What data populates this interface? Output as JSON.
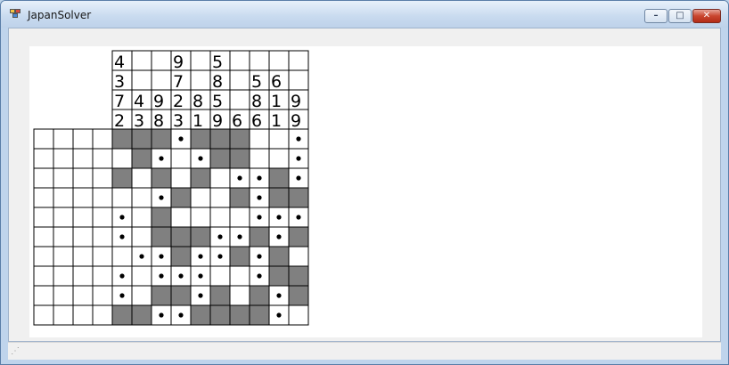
{
  "window": {
    "title": "JapanSolver",
    "controls": {
      "minimize": "–",
      "maximize": "□",
      "close": "✕"
    },
    "icon": "app-icon"
  },
  "puzzle": {
    "rows": 10,
    "cols": 10,
    "row_clue_columns": 4,
    "column_clue_rows": 4,
    "column_clues": [
      [
        "4",
        "3",
        "7",
        "2"
      ],
      [
        "",
        "",
        "4",
        "3"
      ],
      [
        "",
        "",
        "9",
        "8"
      ],
      [
        "9",
        "7",
        "2",
        "3"
      ],
      [
        "",
        "",
        "8",
        "1"
      ],
      [
        "5",
        "8",
        "5",
        "9"
      ],
      [
        "",
        "",
        "",
        "6"
      ],
      [
        "",
        "5",
        "8",
        "6"
      ],
      [
        "",
        "6",
        "1",
        "1"
      ],
      [
        "",
        "",
        "9",
        "9"
      ]
    ],
    "row_clues": [
      [
        "",
        "",
        "",
        ""
      ],
      [
        "",
        "",
        "",
        ""
      ],
      [
        "",
        "",
        "",
        ""
      ],
      [
        "",
        "",
        "",
        ""
      ],
      [
        "",
        "",
        "",
        ""
      ],
      [
        "",
        "",
        "",
        ""
      ],
      [
        "",
        "",
        "",
        ""
      ],
      [
        "",
        "",
        "",
        ""
      ],
      [
        "",
        "",
        "",
        ""
      ],
      [
        "",
        "",
        "",
        ""
      ]
    ],
    "cells": [
      "FFF.FFF  .",
      " F. .FF  .",
      "F F F ..F.",
      "  .F  F.FF",
      ". F    ...",
      ". FFF..F.F",
      " ..F..F.F ",
      ". ...  .FF",
      ". FF.F F.F",
      "FF..FFFF. "
    ],
    "cell_legend": {
      "F": "filled",
      ".": "marked-empty",
      " ": "unknown"
    },
    "colors": {
      "filled": "#808080",
      "grid": "#000000",
      "background": "#ffffff"
    }
  }
}
